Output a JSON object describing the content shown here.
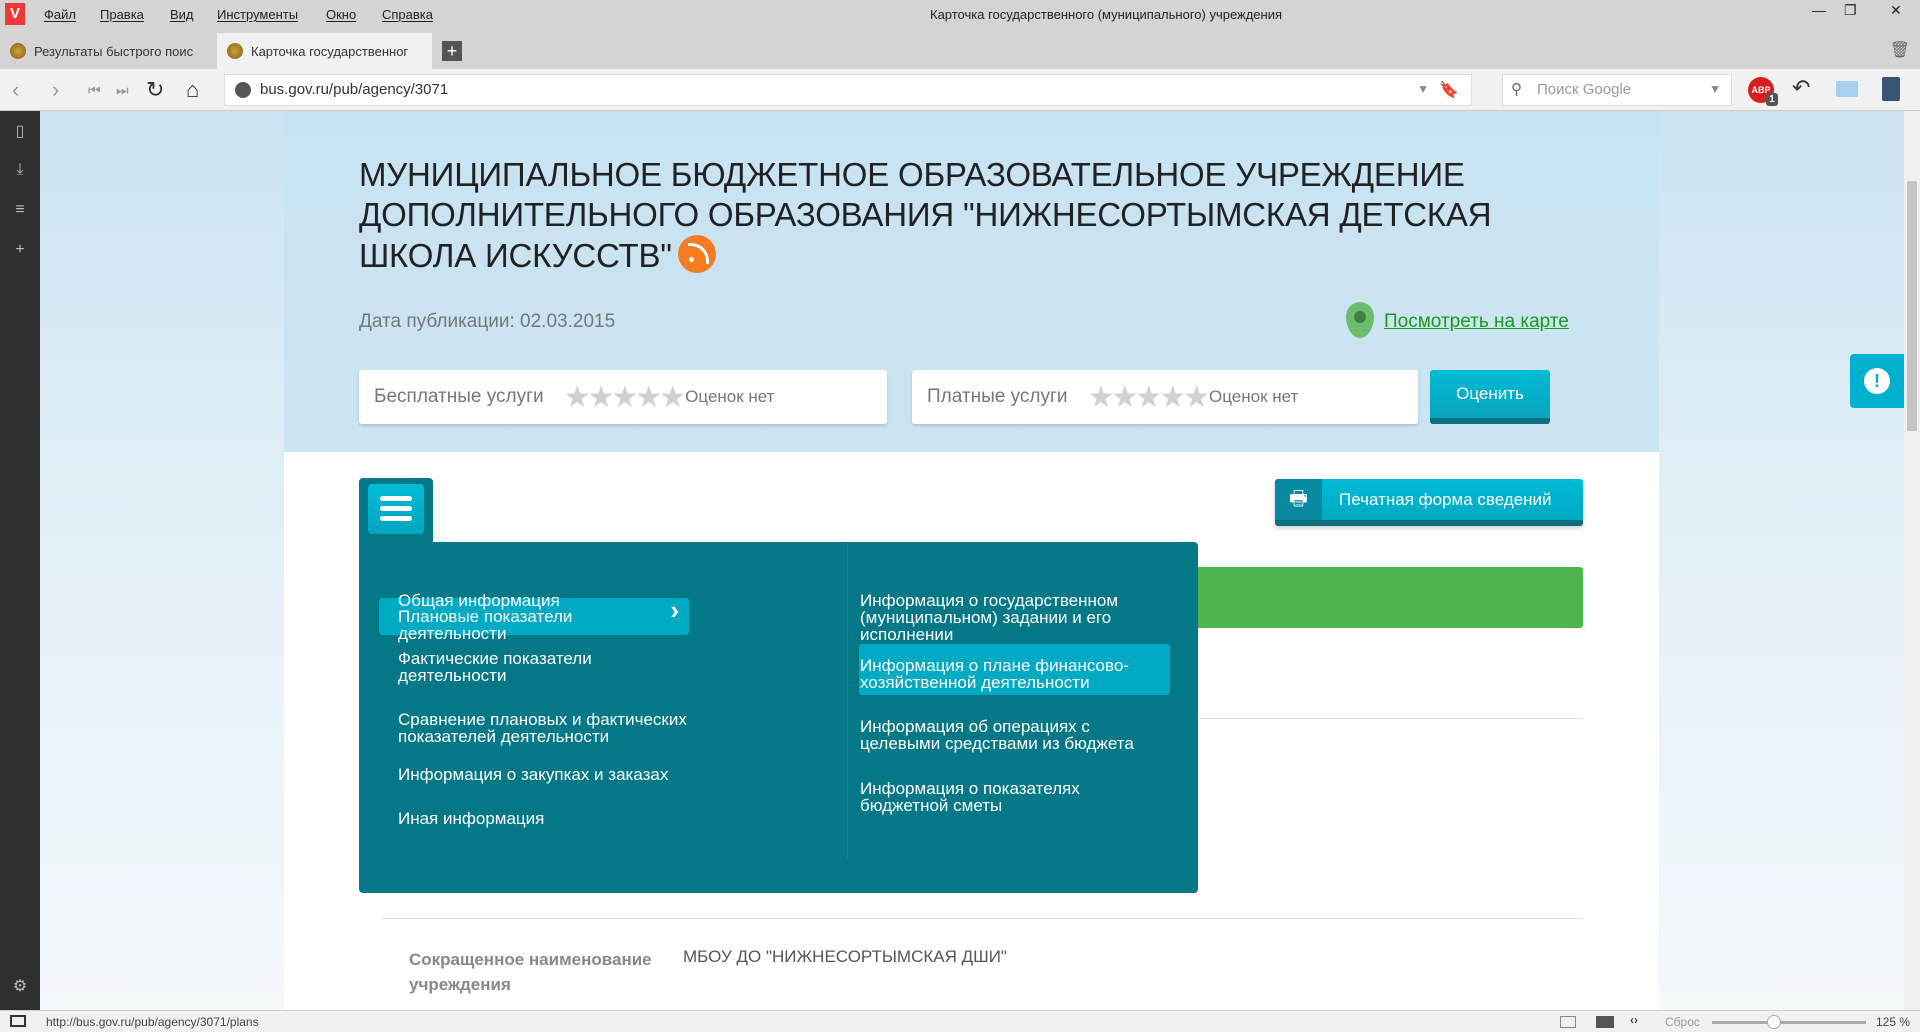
{
  "browser": {
    "menu": [
      "Файл",
      "Правка",
      "Вид",
      "Инструменты",
      "Окно",
      "Справка"
    ],
    "window_title": "Карточка государственного (муниципального) учреждения",
    "tabs": [
      {
        "label": "Результаты быстрого поис"
      },
      {
        "label": "Карточка государственног"
      }
    ],
    "url": "bus.gov.ru/pub/agency/3071",
    "search_placeholder": "Поиск Google",
    "adblock_count": "1",
    "status_url": "http://bus.gov.ru/pub/agency/3071/plans",
    "zoom_reset": "Сброс",
    "zoom_level": "125 %",
    "zoom_fraction": 0.4
  },
  "page": {
    "title": "МУНИЦИПАЛЬНОЕ БЮДЖЕТНОЕ ОБРАЗОВАТЕЛЬНОЕ УЧРЕЖДЕНИЕ ДОПОЛНИТЕЛЬНОГО ОБРАЗОВАНИЯ \"НИЖНЕСОРТЫМСКАЯ ДЕТСКАЯ ШКОЛА ИСКУССТВ\"",
    "publication_date": "Дата публикации: 02.03.2015",
    "map_link": "Посмотреть на карте",
    "ratings": [
      {
        "label": "Бесплатные услуги",
        "stars": 0,
        "status": "Оценок нет"
      },
      {
        "label": "Платные услуги",
        "stars": 0,
        "status": "Оценок нет"
      }
    ],
    "rate_button": "Оценить",
    "print_button": "Печатная форма сведений",
    "menu_left": [
      "Общая информация",
      "Плановые показатели деятельности",
      "Фактические показатели деятельности",
      "Сравнение плановых и фактических показателей деятельности",
      "Информация о закупках и заказах",
      "Иная информация"
    ],
    "menu_right": [
      "Информация о государственном (муниципальном) задании и его исполнении",
      "Информация о плане финансово-хозяйственной деятельности",
      "Информация об операциях с целевыми средствами из бюджета",
      "Информация о показателях бюджетной сметы"
    ],
    "short_name_label": "Сокращенное наименование учреждения",
    "short_name_value": "МБОУ ДО \"НИЖНЕСОРТЫМСКАЯ ДШИ\""
  },
  "colors": {
    "teal": "#057887",
    "accent": "#00a9c4",
    "green": "#4cb54e"
  }
}
